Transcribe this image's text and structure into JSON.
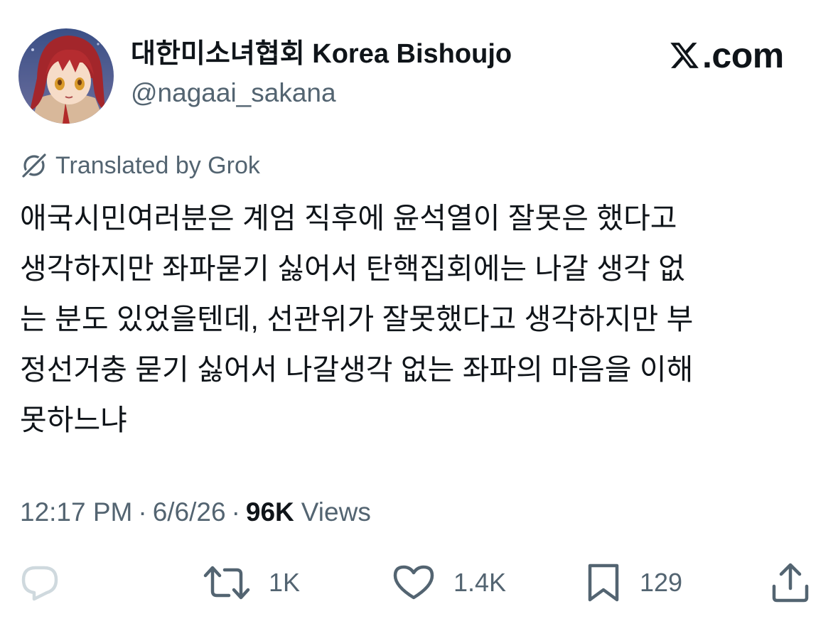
{
  "author": {
    "display_name": "대한미소녀협회 Korea Bishoujo",
    "handle": "@nagaai_sakana"
  },
  "brand": {
    "logo_text": ".com",
    "icon": "x-logo-icon"
  },
  "translation": {
    "label": "Translated by Grok",
    "icon": "grok-icon"
  },
  "tweet": {
    "lines": [
      "애국시민여러분은 계엄 직후에 윤석열이 잘못은 했다고",
      "생각하지만 좌파묻기 싫어서 탄핵집회에는 나갈 생각 없",
      "는 분도 있었을텐데, 선관위가 잘못했다고 생각하지만 부",
      "정선거충 묻기 싫어서 나갈생각 없는 좌파의 마음을 이해",
      "못하느냐"
    ]
  },
  "meta": {
    "time": "12:17 PM",
    "separator": "·",
    "date": "6/6/26",
    "views_count": "96K",
    "views_label": "Views"
  },
  "actions": {
    "reply": {
      "icon": "reply-icon",
      "count": ""
    },
    "retweet": {
      "icon": "retweet-icon",
      "count": "1K"
    },
    "like": {
      "icon": "heart-icon",
      "count": "1.4K"
    },
    "bookmark": {
      "icon": "bookmark-icon",
      "count": "129"
    },
    "share": {
      "icon": "share-icon"
    }
  },
  "colors": {
    "text_primary": "#0f1419",
    "text_secondary": "#536471",
    "reply_icon": "#cfd9de",
    "background": "#ffffff"
  }
}
